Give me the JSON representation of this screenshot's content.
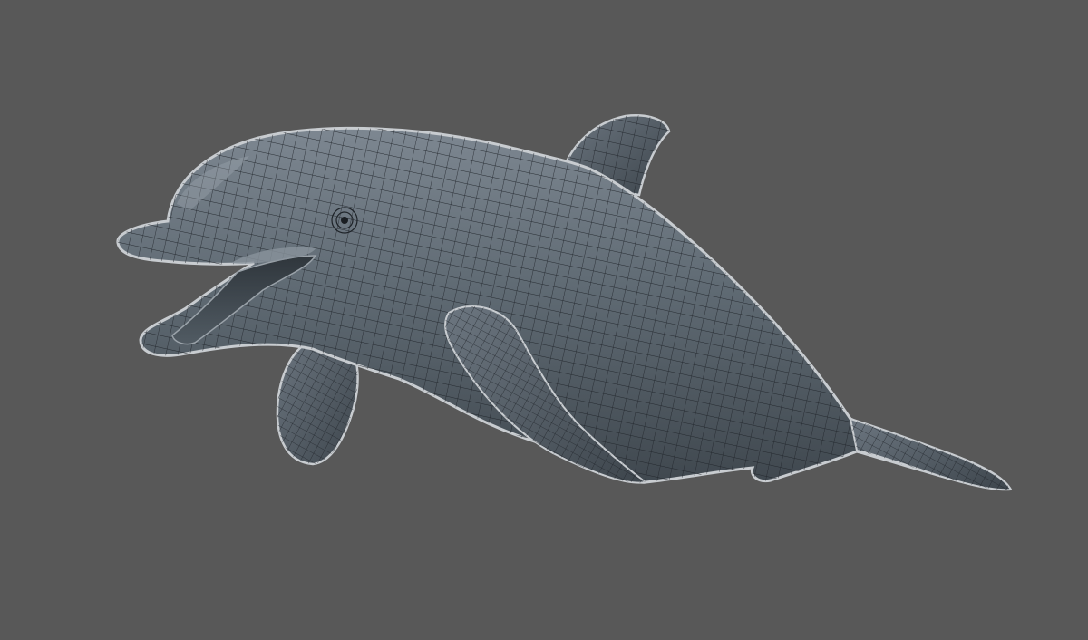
{
  "viewport": {
    "background_color": "#585858",
    "model": {
      "subject": "dolphin",
      "display_mode": "wireframe-on-shaded",
      "surface_color": "#5d6770",
      "wire_color": "#1e2328",
      "outline_color": "#c8ccd0",
      "selected": true
    }
  }
}
